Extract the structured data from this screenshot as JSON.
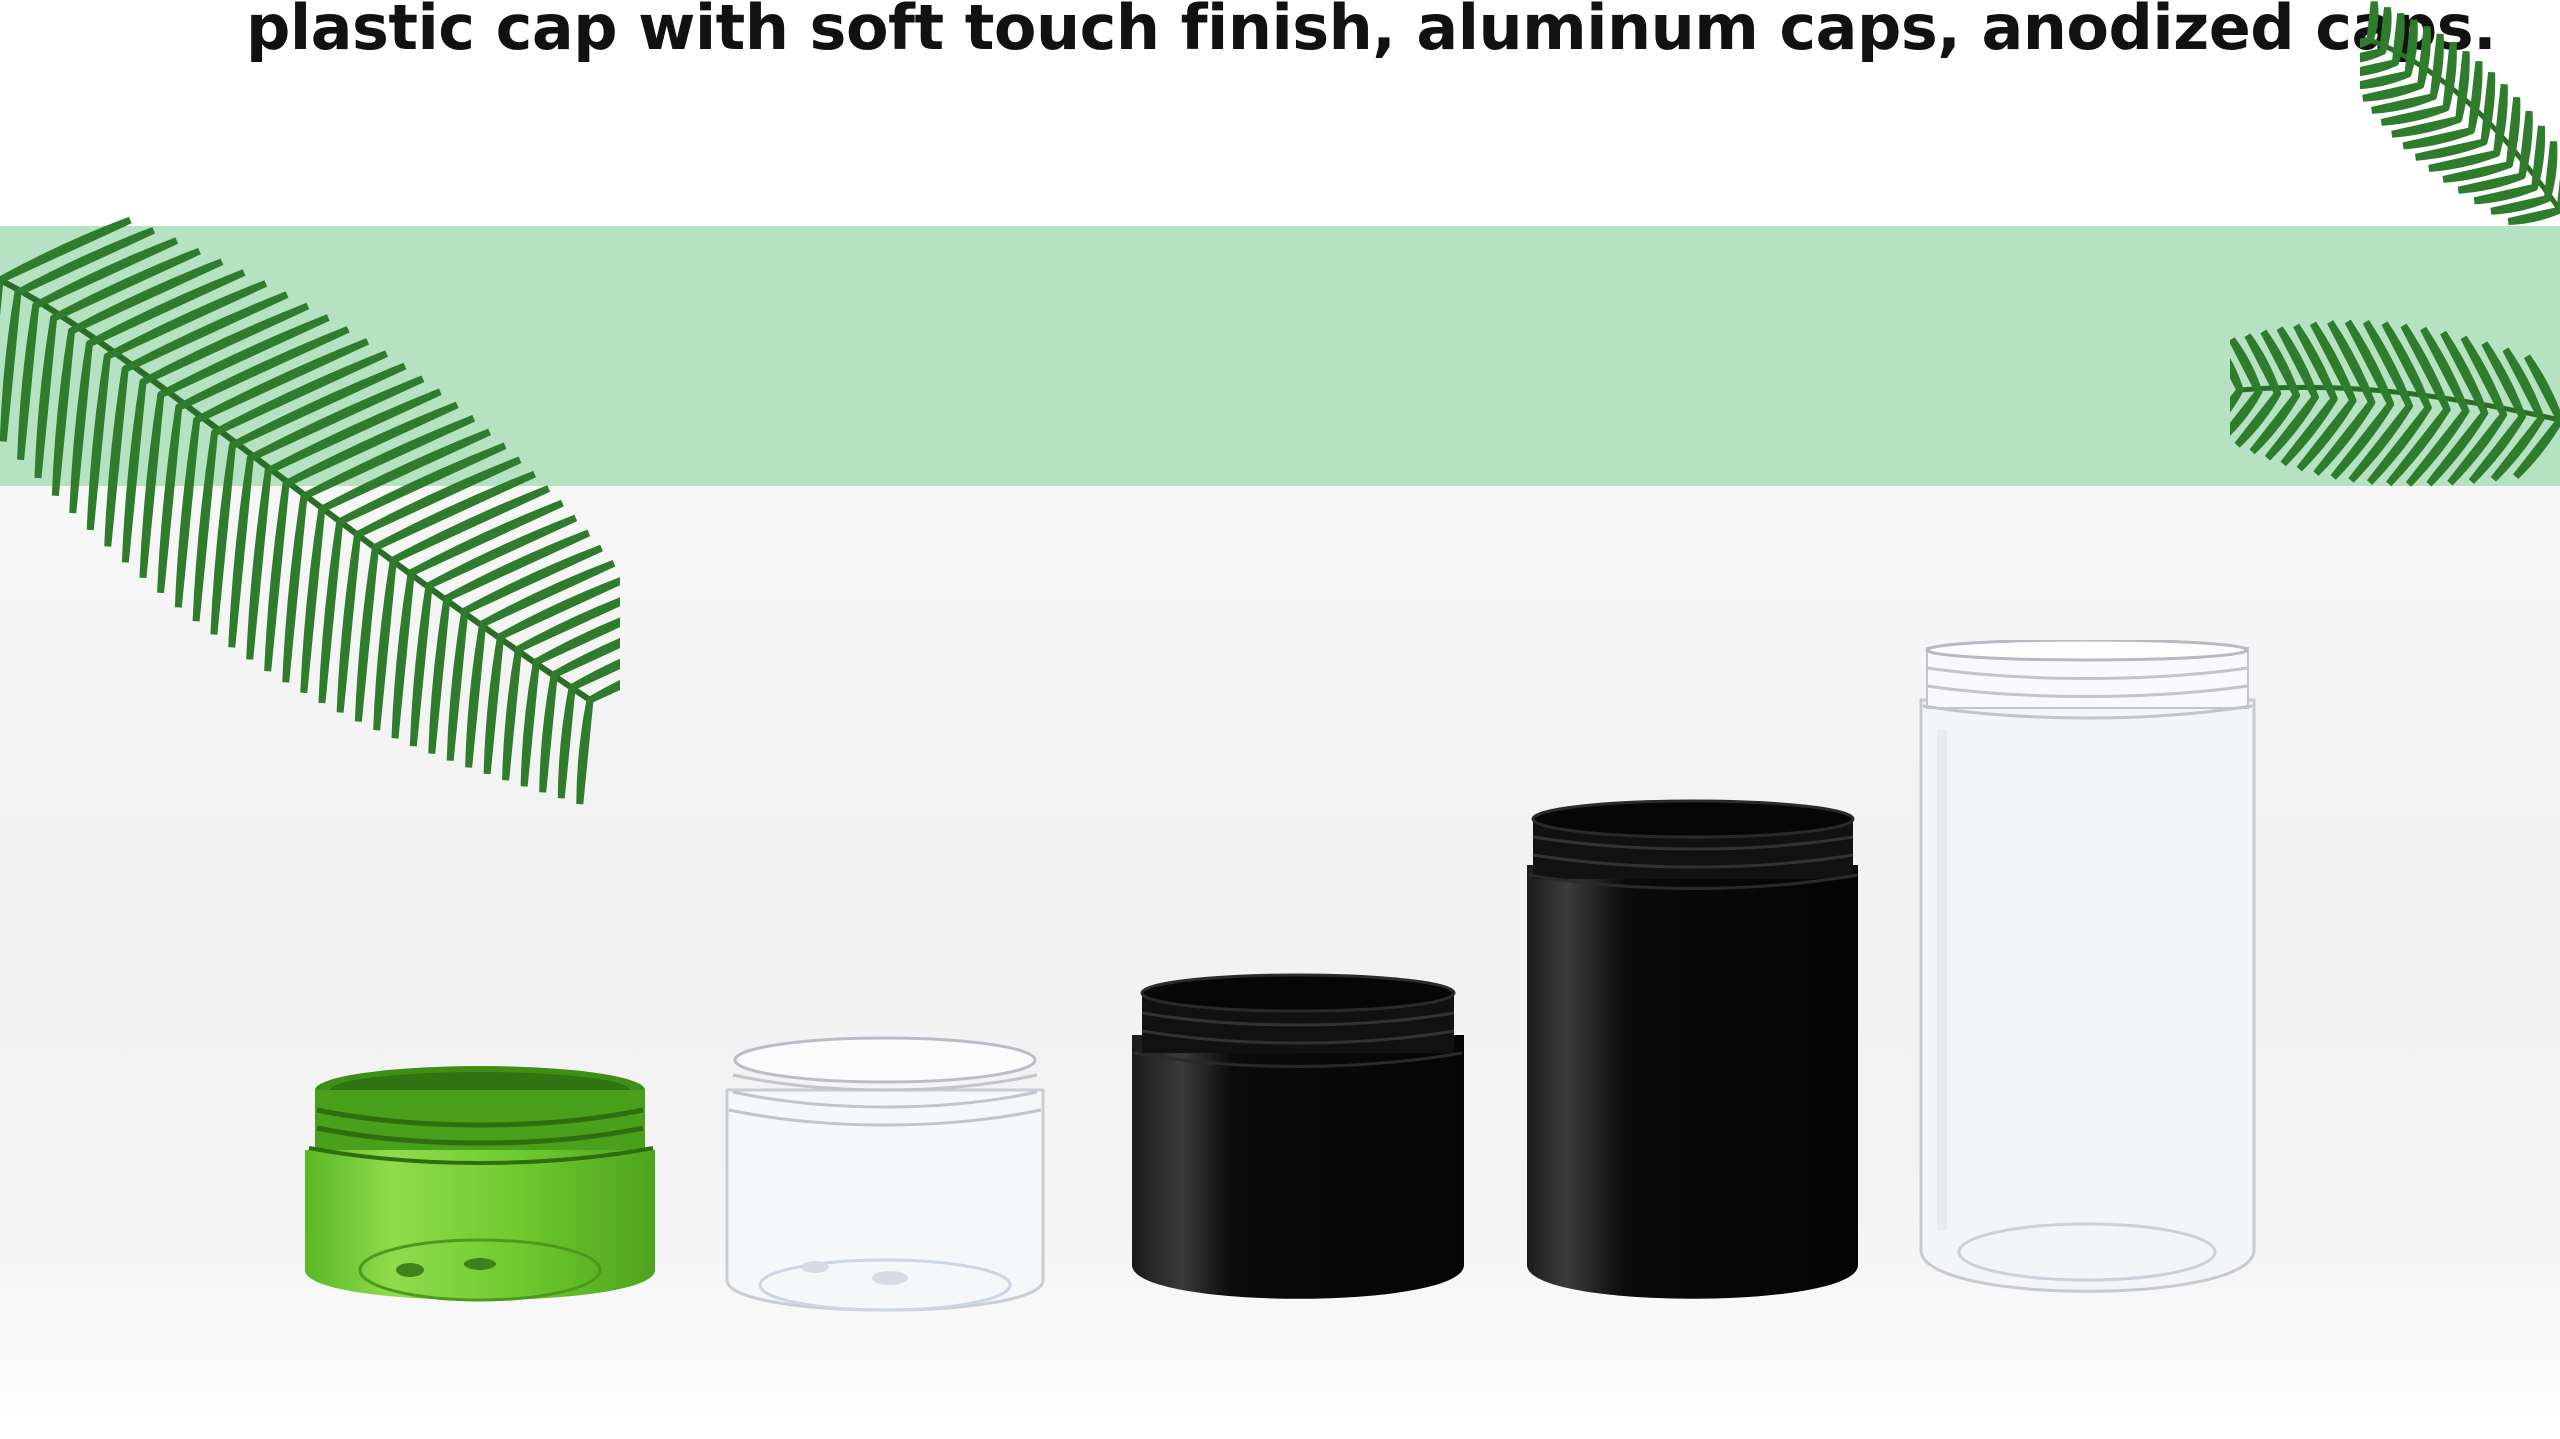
{
  "caption": {
    "text": "plastic cap with soft touch finish, aluminum caps, anodized caps."
  },
  "colors": {
    "band": "#b4e2c3",
    "leaf_dark": "#2f7d2c",
    "leaf_light": "#57a84a",
    "jar_green": "#6fcb2e",
    "jar_black": "#0b0b0b",
    "jar_clear_edge": "#c9ccd2"
  },
  "products": [
    {
      "name": "green-translucent-jar",
      "color": "green"
    },
    {
      "name": "clear-short-jar",
      "color": "clear"
    },
    {
      "name": "black-medium-jar",
      "color": "black"
    },
    {
      "name": "black-tall-jar",
      "color": "black"
    },
    {
      "name": "clear-tall-jar",
      "color": "clear"
    }
  ]
}
